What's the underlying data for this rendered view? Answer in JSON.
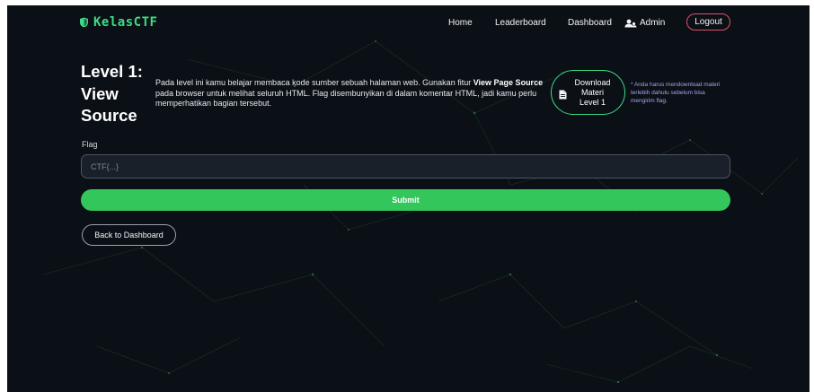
{
  "brand": {
    "icon": "shield-icon",
    "name": "KelasCTF",
    "color": "#3ddc84"
  },
  "nav": {
    "home": "Home",
    "leaderboard": "Leaderboard",
    "dashboard": "Dashboard",
    "admin": "Admin",
    "admin_icon": "users-icon",
    "logout": "Logout",
    "logout_border_color": "#e0506a"
  },
  "level": {
    "title_lines": [
      "Level 1:",
      "View",
      "Source"
    ],
    "description": {
      "part1": "Pada level ini kamu belajar membaca kode sumber sebuah halaman web. Gunakan fitur ",
      "bold1": "View Page Source",
      "part2": " pada browser untuk melihat seluruh HTML. Flag disembunyikan di dalam komentar HTML, jadi kamu perlu memperhatikan bagian tersebut."
    }
  },
  "download": {
    "icon": "file-icon",
    "lines": [
      "Download",
      "Materi",
      "Level 1"
    ],
    "note": "* Anda harus mendownload materi terlebih dahulu sebelum bisa mengirim flag."
  },
  "form": {
    "flag_label": "Flag",
    "flag_placeholder": "CTF{...}",
    "flag_value": "",
    "submit_label": "Submit",
    "submit_color": "#33c75b"
  },
  "back_label": "Back to Dashboard",
  "colors": {
    "background": "#0b1016",
    "accent": "#3ddc84"
  }
}
